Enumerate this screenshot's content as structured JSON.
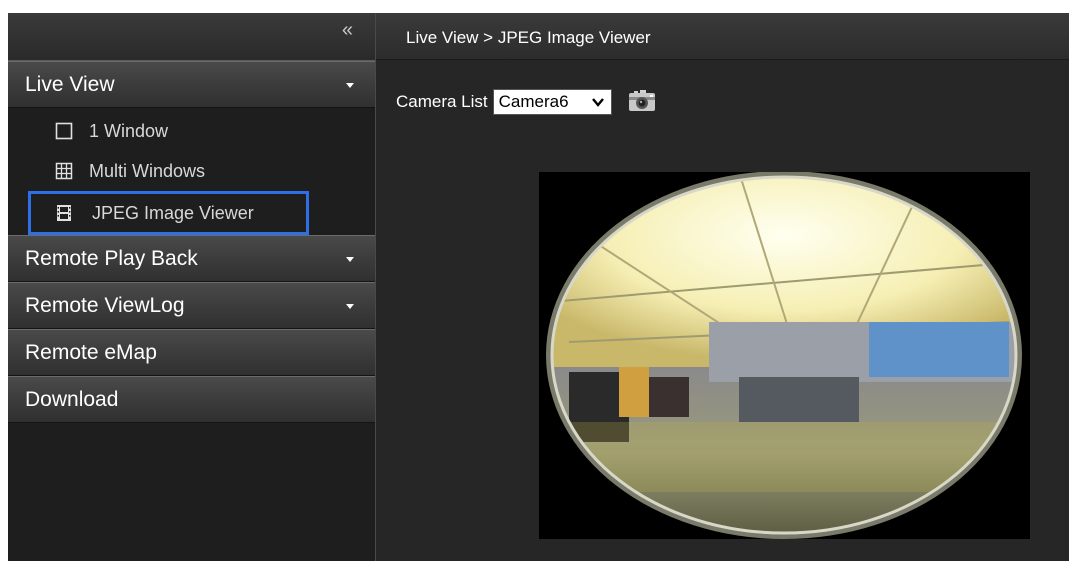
{
  "sidebar": {
    "collapse_icon": "double-chevron-left-icon",
    "collapse_glyph": "«",
    "sections": [
      {
        "label": "Live View",
        "expanded": true
      },
      {
        "label": "Remote Play Back"
      },
      {
        "label": "Remote ViewLog"
      },
      {
        "label": "Remote eMap"
      },
      {
        "label": "Download"
      }
    ],
    "live_view_items": [
      {
        "label": "1 Window",
        "icon": "single-window-icon"
      },
      {
        "label": "Multi Windows",
        "icon": "grid-windows-icon"
      },
      {
        "label": "JPEG Image Viewer",
        "icon": "film-strip-icon",
        "active": true
      }
    ]
  },
  "main": {
    "breadcrumb": "Live View > JPEG Image Viewer",
    "camera_list_label": "Camera List",
    "camera_selected": "Camera6",
    "snapshot_icon": "camera-snapshot-icon"
  },
  "colors": {
    "active_border": "#2f6fe6",
    "background": "#262626"
  }
}
